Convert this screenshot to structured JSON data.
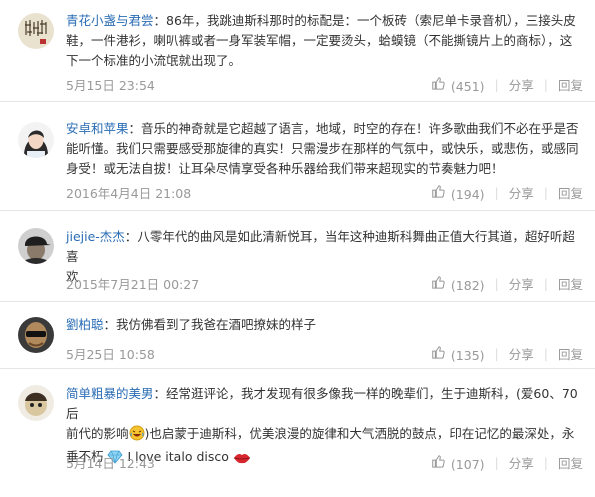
{
  "comments": [
    {
      "user": "青花小盏与君尝",
      "text_lines": [
        "86年，我跳迪斯科那时的标配是：一个板砖（索尼单卡录音机），三接头皮",
        "鞋，一件港衫，喇叭裤或者一身军装军帽，一定要烫头，蛤蟆镜（不能撕镜片上的商标），这",
        "下一个标准的小流氓就出现了。"
      ],
      "time": "5月15日 23:54",
      "likes": "(451)",
      "share": "分享",
      "reply": "回复"
    },
    {
      "user": "安卓和苹果",
      "text_lines": [
        "音乐的神奇就是它超越了语言，地域，时空的存在！许多歌曲我们不必在乎是否",
        "能听懂。我们只需要感受那旋律的真实！只需漫步在那样的气氛中，或快乐，或悲伤，或感同",
        "身受！或无法自拔！让耳朵尽情享受各种乐器给我们带来超现实的节奏魅力吧！"
      ],
      "time": "2016年4月4日 21:08",
      "likes": "(194)",
      "share": "分享",
      "reply": "回复"
    },
    {
      "user": "jiejie-杰杰",
      "text_lines": [
        "八零年代的曲风是如此清新悦耳，当年这种迪斯科舞曲正值大行其道，超好听超喜",
        "欢"
      ],
      "time": "2015年7月21日 00:27",
      "likes": "(182)",
      "share": "分享",
      "reply": "回复"
    },
    {
      "user": "劉柏聪",
      "text_lines": [
        "我仿佛看到了我爸在酒吧撩妹的样子"
      ],
      "time": "5月25日 10:58",
      "likes": "(135)",
      "share": "分享",
      "reply": "回复"
    },
    {
      "user": "简单粗暴的美男",
      "text_line1": "经常逛评论，我才发现有很多像我一样的晚辈们，生于迪斯科，(爱60、70后",
      "text_line2a": "前代的影响",
      "text_line2b": ")也启蒙于迪斯科，优美浪漫的旋律和大气洒脱的鼓点，印在记忆的最深处，永",
      "text_line3a": "垂不朽 ",
      "text_line3b": "I love italo disco",
      "time": "5月14日 12:43",
      "likes": "(107)",
      "share": "分享",
      "reply": "回复"
    }
  ],
  "colors": {
    "username": "#2a6cb5",
    "meta": "#999999",
    "divider": "#e6e6e6"
  },
  "icons": [
    "thumbs-up-icon",
    "laughing-emoji-icon",
    "diamond-emoji-icon",
    "lips-emoji-icon"
  ]
}
